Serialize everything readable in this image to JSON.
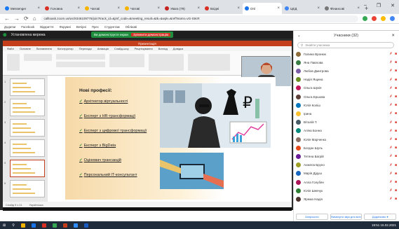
{
  "tabs": [
    {
      "label": "Messenger",
      "color": "#1877f2",
      "active": false
    },
    {
      "label": "Головна",
      "color": "#d93025",
      "active": false
    },
    {
      "label": "Чатові",
      "color": "#f4b400",
      "active": false
    },
    {
      "label": "Чатові",
      "color": "#f4b400",
      "active": false
    },
    {
      "label": "Увага (79)",
      "color": "#c5221f",
      "active": false
    },
    {
      "label": "Вхідні",
      "color": "#d93025",
      "active": false
    },
    {
      "label": "Onl",
      "color": "#1a73e8",
      "active": true
    },
    {
      "label": "ЦЕД",
      "color": "#4285f4",
      "active": false
    },
    {
      "label": "Фінансові",
      "color": "#777777",
      "active": false
    }
  ],
  "newtab": "+",
  "window": {
    "min": "–",
    "max": "❐",
    "close": "✕"
  },
  "address": {
    "url": "calltoask.zoom.us/wc/8346109776/join?track_id=&jmf_code=&meeting_result=&tk=&wpk=&refTeams=vG-S9cR",
    "back": "←",
    "forward": "→",
    "reload": "⟳",
    "home": "⌂"
  },
  "bookmarks": [
    "Додатки",
    "Facebook",
    "Відкриття",
    "Форумні",
    "Вечірні",
    "Прес",
    "Студентам",
    "Облікові"
  ],
  "meeting": {
    "title": "Стіл",
    "label2": "Установлена мережа",
    "banner": "Ви демонструєте екран",
    "banner_stop": "Зупинити демонстрацію",
    "ppt_title": "Презентація",
    "ribbon_tabs": [
      "Файл",
      "Основне",
      "Вставлення",
      "Конструктор",
      "Переходи",
      "Анімація",
      "Слайд-шоу",
      "Рецензування",
      "Вигляд",
      "Довідка"
    ],
    "cam_name": "Маргарита"
  },
  "slide": {
    "heading": "Нові професії:",
    "bullets": [
      "Архітектор віртуальності",
      "Експерт з HR-трансформації",
      "Експерт з цифрової трансформації",
      "Експерт з BigData",
      "Оцінювач трансакцій",
      "Персональний IT-консультант"
    ]
  },
  "status_text": [
    "Слайд 5 з 11",
    "Українська"
  ],
  "participants": {
    "title": "Учасники (32)",
    "search_placeholder": "Знайти учасника",
    "list": [
      {
        "name": "Галина Вронюк",
        "color": "#8e6c3a"
      },
      {
        "name": "Яна Павлова",
        "color": "#3a7d44"
      },
      {
        "name": "Любов Дмитрова",
        "color": "#7b5ea7"
      },
      {
        "name": "Надія Ящина",
        "color": "#6b8e23"
      },
      {
        "name": "Ольга Шукія",
        "color": "#c2185b"
      },
      {
        "name": "Ольга Ершова",
        "color": "#5d4037"
      },
      {
        "name": "Юлія Коліш",
        "color": "#0277bd"
      },
      {
        "name": "Ірина",
        "color": "#fbc02d"
      },
      {
        "name": "Віталій Т.",
        "color": "#455a64"
      },
      {
        "name": "Аліна Бонна",
        "color": "#00897b"
      },
      {
        "name": "Юлія Марченко",
        "color": "#8d6e63"
      },
      {
        "name": "Богдан Шуль",
        "color": "#e64a19"
      },
      {
        "name": "Тетяна Багрій",
        "color": "#6a1b9a"
      },
      {
        "name": "Анжела Бруно",
        "color": "#9e9d24"
      },
      {
        "name": "Марія Дідуш",
        "color": "#1565c0"
      },
      {
        "name": "Алла Голубян",
        "color": "#ad1457"
      },
      {
        "name": "Юлія Шевчук",
        "color": "#2e7d32"
      },
      {
        "name": "Ярема Надія",
        "color": "#4e342e"
      }
    ],
    "icon_glyphs": "✗ ■",
    "btn_invite": "Запросити",
    "btn_mute": "Вимкнути звук для всіх",
    "btn_more": "Додатково ▾"
  },
  "taskbar": {
    "start": "⊞",
    "search": "⚲",
    "time": "19:51",
    "date": "15.02.2021"
  }
}
